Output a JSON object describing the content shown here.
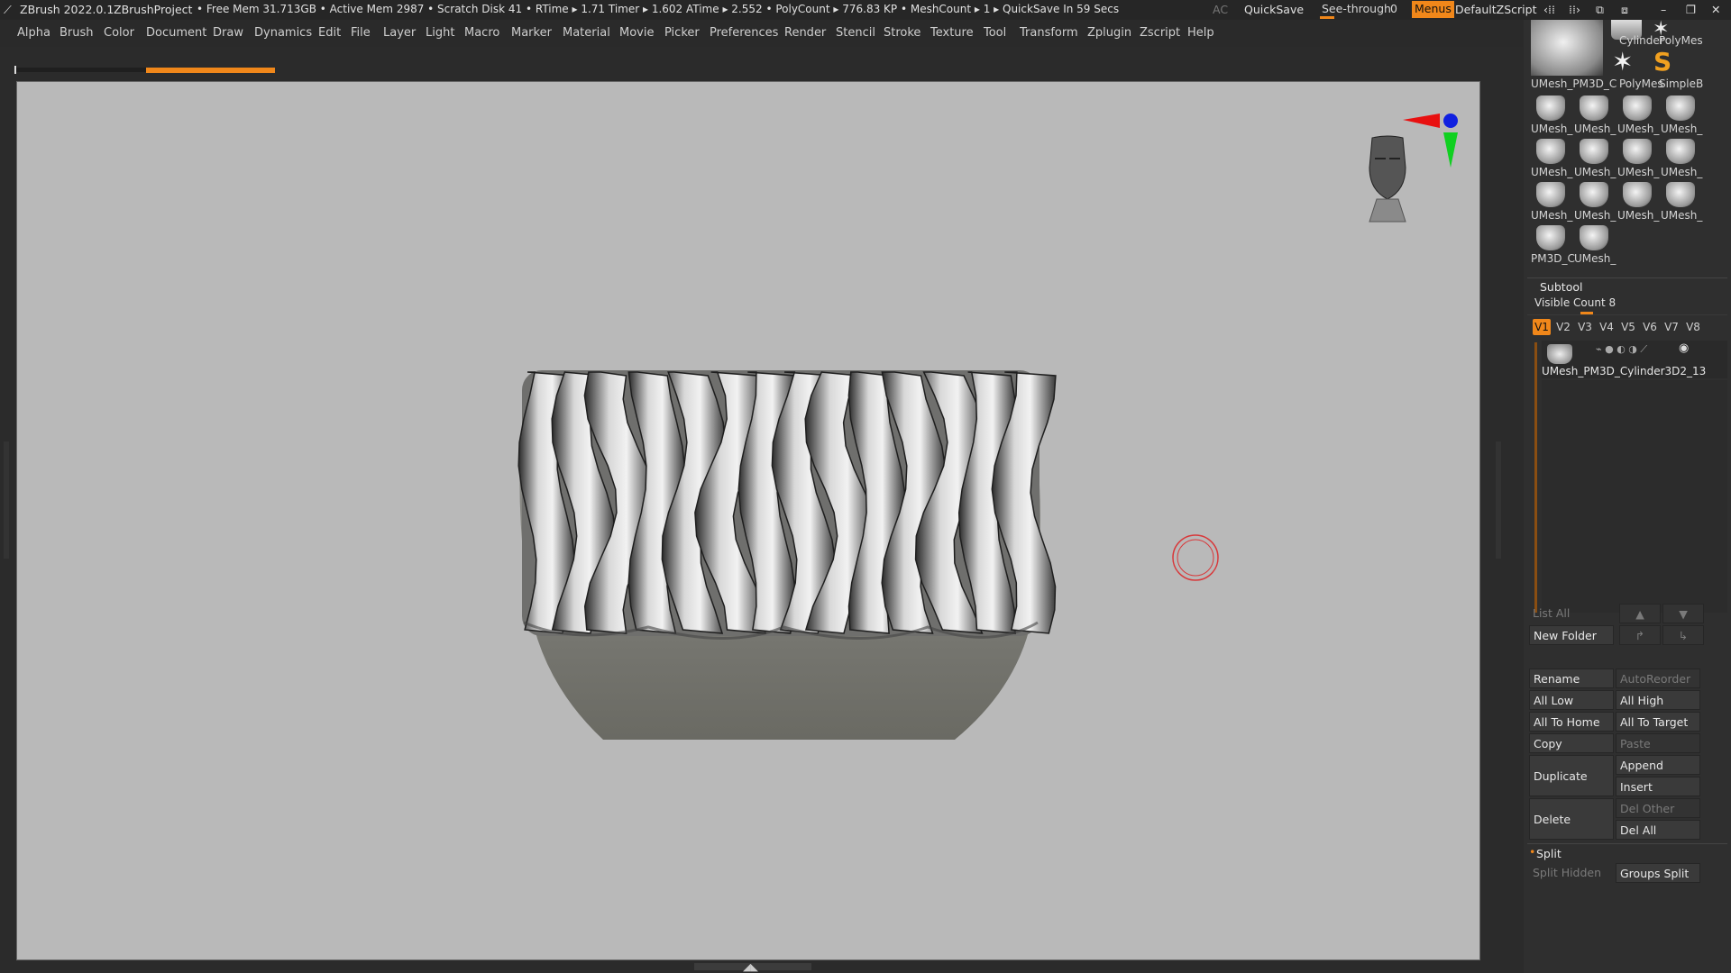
{
  "app": {
    "title": "ZBrush 2022.0.1",
    "project": "ZBrushProject",
    "status": "• Free Mem 31.713GB • Active Mem 2987 • Scratch Disk 41 •  RTime ▸ 1.71 Timer ▸ 1.602 ATime ▸ 2.552 • PolyCount ▸ 776.83 KP  • MeshCount ▸ 1   ▸ QuickSave In 59 Secs",
    "ac_label": "AC",
    "quicksave_label": "QuickSave",
    "seethrough_label": "See-through",
    "seethrough_value": "0",
    "menus_label": "Menus",
    "zscript_label": "DefaultZScript"
  },
  "menus": [
    "Alpha",
    "Brush",
    "Color",
    "Document",
    "Draw",
    "Dynamics",
    "Edit",
    "File",
    "Layer",
    "Light",
    "Macro",
    "Marker",
    "Material",
    "Movie",
    "Picker",
    "Preferences",
    "Render",
    "Stencil",
    "Stroke",
    "Texture",
    "Tool",
    "Transform",
    "Zplugin",
    "Zscript",
    "Help"
  ],
  "progress": 0.5,
  "tool_palette": {
    "top_labels": [
      "UMesh_PM3D_C",
      "Cylinder",
      "PolyMes",
      "PolyMes",
      "SimpleB"
    ],
    "grid_rows": [
      [
        "UMesh_",
        "UMesh_",
        "UMesh_",
        "UMesh_"
      ],
      [
        "UMesh_",
        "UMesh_",
        "UMesh_",
        "UMesh_"
      ],
      [
        "UMesh_",
        "UMesh_",
        "UMesh_",
        "UMesh_"
      ],
      [
        "PM3D_C",
        "UMesh_"
      ]
    ]
  },
  "subtool": {
    "title": "Subtool",
    "visible_count_label": "Visible Count 8",
    "versions": [
      "V1",
      "V2",
      "V3",
      "V4",
      "V5",
      "V6",
      "V7",
      "V8"
    ],
    "item_name": "UMesh_PM3D_Cylinder3D2_13",
    "list_all": "List All",
    "new_folder": "New Folder",
    "rename": "Rename",
    "autoreorder": "AutoReorder",
    "all_low": "All Low",
    "all_high": "All High",
    "all_to_home": "All To Home",
    "all_to_target": "All To Target",
    "copy": "Copy",
    "paste": "Paste",
    "duplicate": "Duplicate",
    "append": "Append",
    "insert": "Insert",
    "delete": "Delete",
    "del_other": "Del Other",
    "del_all": "Del All",
    "split_title": "Split",
    "split_hidden": "Split Hidden",
    "groups_split": "Groups Split"
  },
  "colors": {
    "accent": "#f0871a",
    "viewport_bg": "#bbbbbb",
    "panel_bg": "#2f2f2f"
  }
}
